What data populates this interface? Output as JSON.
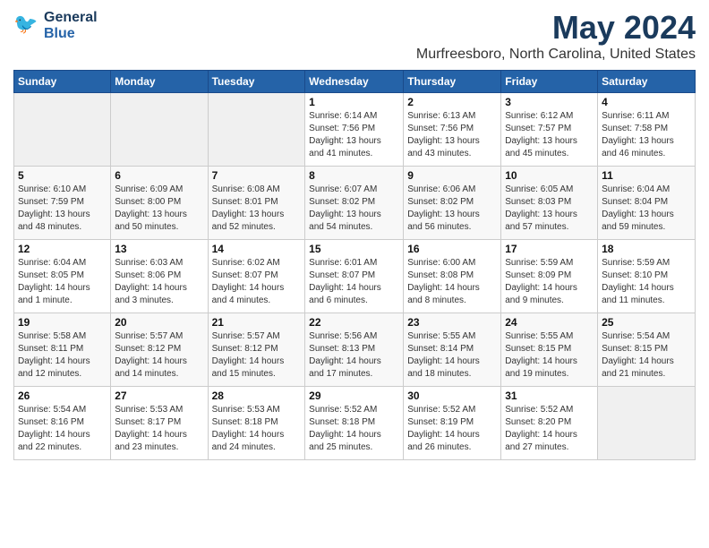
{
  "logo": {
    "line1": "General",
    "line2": "Blue"
  },
  "title": "May 2024",
  "subtitle": "Murfreesboro, North Carolina, United States",
  "weekdays": [
    "Sunday",
    "Monday",
    "Tuesday",
    "Wednesday",
    "Thursday",
    "Friday",
    "Saturday"
  ],
  "weeks": [
    [
      {
        "day": "",
        "detail": ""
      },
      {
        "day": "",
        "detail": ""
      },
      {
        "day": "",
        "detail": ""
      },
      {
        "day": "1",
        "detail": "Sunrise: 6:14 AM\nSunset: 7:56 PM\nDaylight: 13 hours\nand 41 minutes."
      },
      {
        "day": "2",
        "detail": "Sunrise: 6:13 AM\nSunset: 7:56 PM\nDaylight: 13 hours\nand 43 minutes."
      },
      {
        "day": "3",
        "detail": "Sunrise: 6:12 AM\nSunset: 7:57 PM\nDaylight: 13 hours\nand 45 minutes."
      },
      {
        "day": "4",
        "detail": "Sunrise: 6:11 AM\nSunset: 7:58 PM\nDaylight: 13 hours\nand 46 minutes."
      }
    ],
    [
      {
        "day": "5",
        "detail": "Sunrise: 6:10 AM\nSunset: 7:59 PM\nDaylight: 13 hours\nand 48 minutes."
      },
      {
        "day": "6",
        "detail": "Sunrise: 6:09 AM\nSunset: 8:00 PM\nDaylight: 13 hours\nand 50 minutes."
      },
      {
        "day": "7",
        "detail": "Sunrise: 6:08 AM\nSunset: 8:01 PM\nDaylight: 13 hours\nand 52 minutes."
      },
      {
        "day": "8",
        "detail": "Sunrise: 6:07 AM\nSunset: 8:02 PM\nDaylight: 13 hours\nand 54 minutes."
      },
      {
        "day": "9",
        "detail": "Sunrise: 6:06 AM\nSunset: 8:02 PM\nDaylight: 13 hours\nand 56 minutes."
      },
      {
        "day": "10",
        "detail": "Sunrise: 6:05 AM\nSunset: 8:03 PM\nDaylight: 13 hours\nand 57 minutes."
      },
      {
        "day": "11",
        "detail": "Sunrise: 6:04 AM\nSunset: 8:04 PM\nDaylight: 13 hours\nand 59 minutes."
      }
    ],
    [
      {
        "day": "12",
        "detail": "Sunrise: 6:04 AM\nSunset: 8:05 PM\nDaylight: 14 hours\nand 1 minute."
      },
      {
        "day": "13",
        "detail": "Sunrise: 6:03 AM\nSunset: 8:06 PM\nDaylight: 14 hours\nand 3 minutes."
      },
      {
        "day": "14",
        "detail": "Sunrise: 6:02 AM\nSunset: 8:07 PM\nDaylight: 14 hours\nand 4 minutes."
      },
      {
        "day": "15",
        "detail": "Sunrise: 6:01 AM\nSunset: 8:07 PM\nDaylight: 14 hours\nand 6 minutes."
      },
      {
        "day": "16",
        "detail": "Sunrise: 6:00 AM\nSunset: 8:08 PM\nDaylight: 14 hours\nand 8 minutes."
      },
      {
        "day": "17",
        "detail": "Sunrise: 5:59 AM\nSunset: 8:09 PM\nDaylight: 14 hours\nand 9 minutes."
      },
      {
        "day": "18",
        "detail": "Sunrise: 5:59 AM\nSunset: 8:10 PM\nDaylight: 14 hours\nand 11 minutes."
      }
    ],
    [
      {
        "day": "19",
        "detail": "Sunrise: 5:58 AM\nSunset: 8:11 PM\nDaylight: 14 hours\nand 12 minutes."
      },
      {
        "day": "20",
        "detail": "Sunrise: 5:57 AM\nSunset: 8:12 PM\nDaylight: 14 hours\nand 14 minutes."
      },
      {
        "day": "21",
        "detail": "Sunrise: 5:57 AM\nSunset: 8:12 PM\nDaylight: 14 hours\nand 15 minutes."
      },
      {
        "day": "22",
        "detail": "Sunrise: 5:56 AM\nSunset: 8:13 PM\nDaylight: 14 hours\nand 17 minutes."
      },
      {
        "day": "23",
        "detail": "Sunrise: 5:55 AM\nSunset: 8:14 PM\nDaylight: 14 hours\nand 18 minutes."
      },
      {
        "day": "24",
        "detail": "Sunrise: 5:55 AM\nSunset: 8:15 PM\nDaylight: 14 hours\nand 19 minutes."
      },
      {
        "day": "25",
        "detail": "Sunrise: 5:54 AM\nSunset: 8:15 PM\nDaylight: 14 hours\nand 21 minutes."
      }
    ],
    [
      {
        "day": "26",
        "detail": "Sunrise: 5:54 AM\nSunset: 8:16 PM\nDaylight: 14 hours\nand 22 minutes."
      },
      {
        "day": "27",
        "detail": "Sunrise: 5:53 AM\nSunset: 8:17 PM\nDaylight: 14 hours\nand 23 minutes."
      },
      {
        "day": "28",
        "detail": "Sunrise: 5:53 AM\nSunset: 8:18 PM\nDaylight: 14 hours\nand 24 minutes."
      },
      {
        "day": "29",
        "detail": "Sunrise: 5:52 AM\nSunset: 8:18 PM\nDaylight: 14 hours\nand 25 minutes."
      },
      {
        "day": "30",
        "detail": "Sunrise: 5:52 AM\nSunset: 8:19 PM\nDaylight: 14 hours\nand 26 minutes."
      },
      {
        "day": "31",
        "detail": "Sunrise: 5:52 AM\nSunset: 8:20 PM\nDaylight: 14 hours\nand 27 minutes."
      },
      {
        "day": "",
        "detail": ""
      }
    ]
  ]
}
